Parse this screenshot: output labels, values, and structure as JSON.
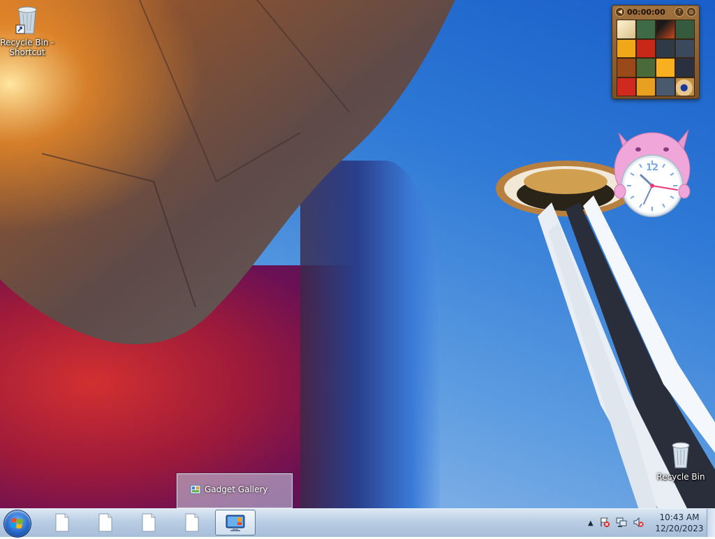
{
  "desktop": {
    "icons": [
      {
        "label": "Recycle Bin - Shortcut",
        "icon": "recycle-bin-shortcut-icon"
      },
      {
        "label": "Recycle Bin",
        "icon": "recycle-bin-icon"
      }
    ]
  },
  "gadgets": {
    "puzzle": {
      "timer": "00:00:00"
    },
    "clock": {
      "number": "12"
    }
  },
  "popup": {
    "item_label": "Gadget Gallery",
    "icon": "gadget-gallery-icon"
  },
  "taskbar": {
    "start_icon": "windows-start-icon",
    "buttons": [
      {
        "icon": "document-icon"
      },
      {
        "icon": "document-icon"
      },
      {
        "icon": "document-icon"
      },
      {
        "icon": "document-icon"
      },
      {
        "icon": "gadget-gallery-icon",
        "active": true
      }
    ],
    "tray": {
      "icons": [
        "show-hidden-icons-arrow",
        "action-center-icon",
        "network-icon",
        "volume-muted-icon"
      ]
    },
    "clock": {
      "time": "10:43 AM",
      "date": "12/20/2023"
    }
  },
  "colors": {
    "taskbar": "#b9cde3",
    "sky": "#2e79d6"
  }
}
